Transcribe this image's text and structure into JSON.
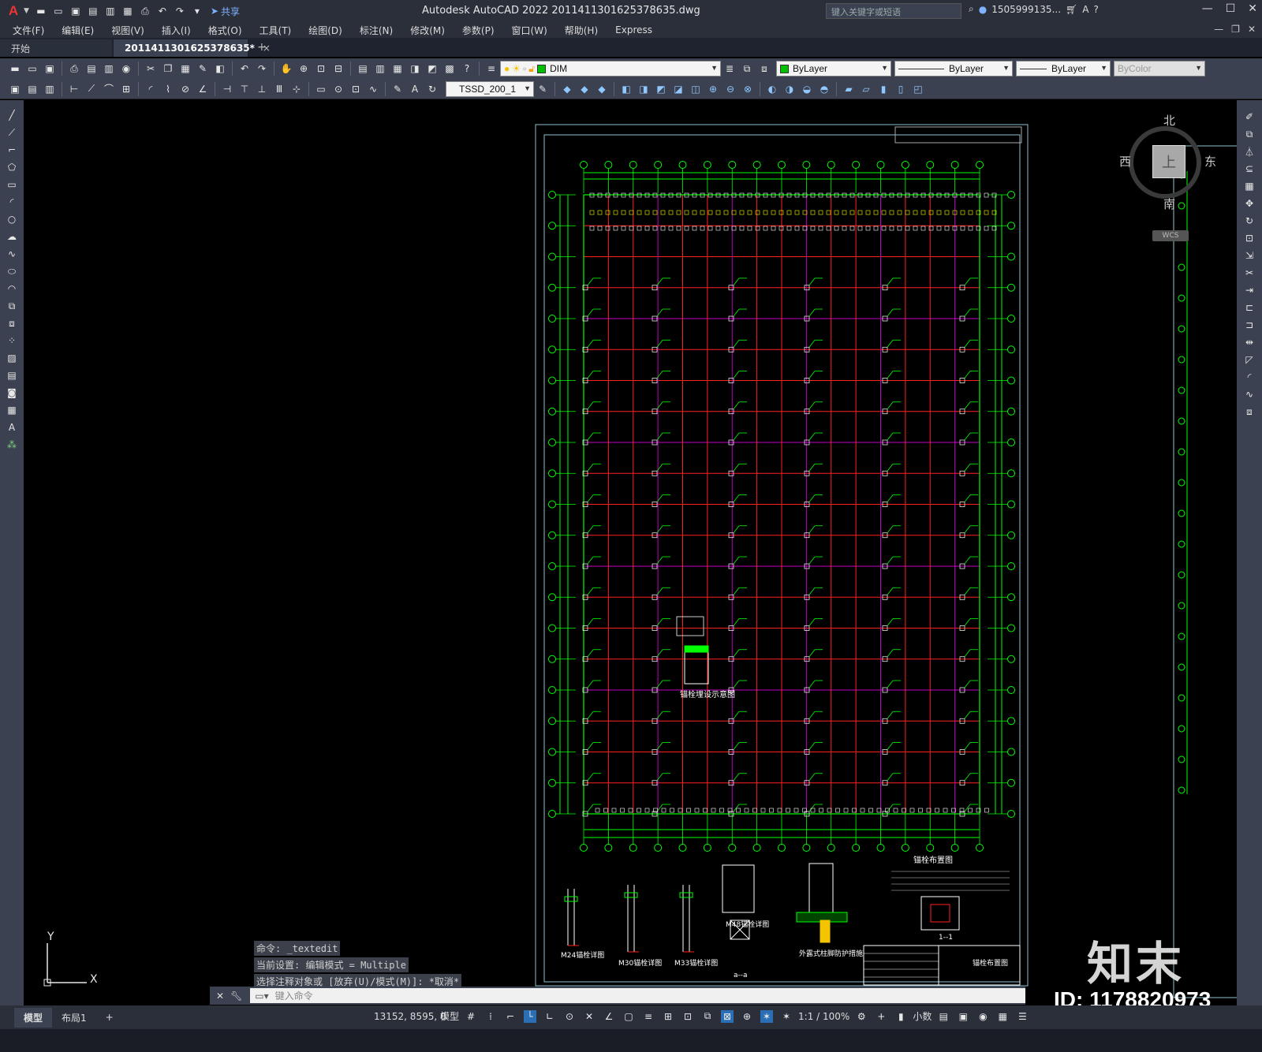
{
  "titlebar": {
    "app_letter": "A",
    "share_label": "共享",
    "title": "Autodesk AutoCAD 2022    2011411301625378635.dwg",
    "search_placeholder": "键入关键字或短语",
    "user": "1505999135...",
    "help": "?"
  },
  "menu": [
    "文件(F)",
    "编辑(E)",
    "视图(V)",
    "插入(I)",
    "格式(O)",
    "工具(T)",
    "绘图(D)",
    "标注(N)",
    "修改(M)",
    "参数(P)",
    "窗口(W)",
    "帮助(H)",
    "Express"
  ],
  "tabs": [
    {
      "label": "开始"
    },
    {
      "label": "2011411301625378635*",
      "close": "×"
    }
  ],
  "tab_add": "+",
  "toolbar": {
    "layer_value": "DIM",
    "color_value": "ByLayer",
    "linetype_value": "ByLayer",
    "lineweight_value": "ByLayer",
    "plotstyle_value": "ByColor",
    "dimstyle_value": "TSSD_200_1",
    "layer_color": "#00c000",
    "bylayer_color": "#00c000"
  },
  "viewcube": {
    "north": "北",
    "south": "南",
    "east": "东",
    "west": "西",
    "top": "上",
    "wcs": "WCS"
  },
  "ucs": {
    "x": "X",
    "y": "Y"
  },
  "command": {
    "history": [
      "命令: _textedit",
      "当前设置: 编辑模式 = Multiple",
      "选择注释对象或 [放弃(U)/模式(M)]: *取消*"
    ],
    "placeholder": "键入命令"
  },
  "drawing": {
    "main_title": "锚栓布置图",
    "detail_titles": [
      "M24锚栓详图",
      "M30锚栓详图",
      "M33锚栓详图",
      "M48锚栓详图",
      "外露式柱脚防护措施",
      "锚栓埋设示意图"
    ],
    "section_label": "1--1",
    "section_label2": "a--a",
    "title_block_name": "锚栓布置图",
    "grid_color": "#00ff00",
    "line_red": "#ff2020",
    "line_magenta": "#c000c0"
  },
  "brand": {
    "name": "知末",
    "id": "ID: 1178820973"
  },
  "status": {
    "layout_tabs": [
      "模型",
      "布局1"
    ],
    "layout_add": "+",
    "coords": "13152, 8595, 0",
    "model": "模型",
    "scale": "1:1 / 100%",
    "units": "小数"
  }
}
